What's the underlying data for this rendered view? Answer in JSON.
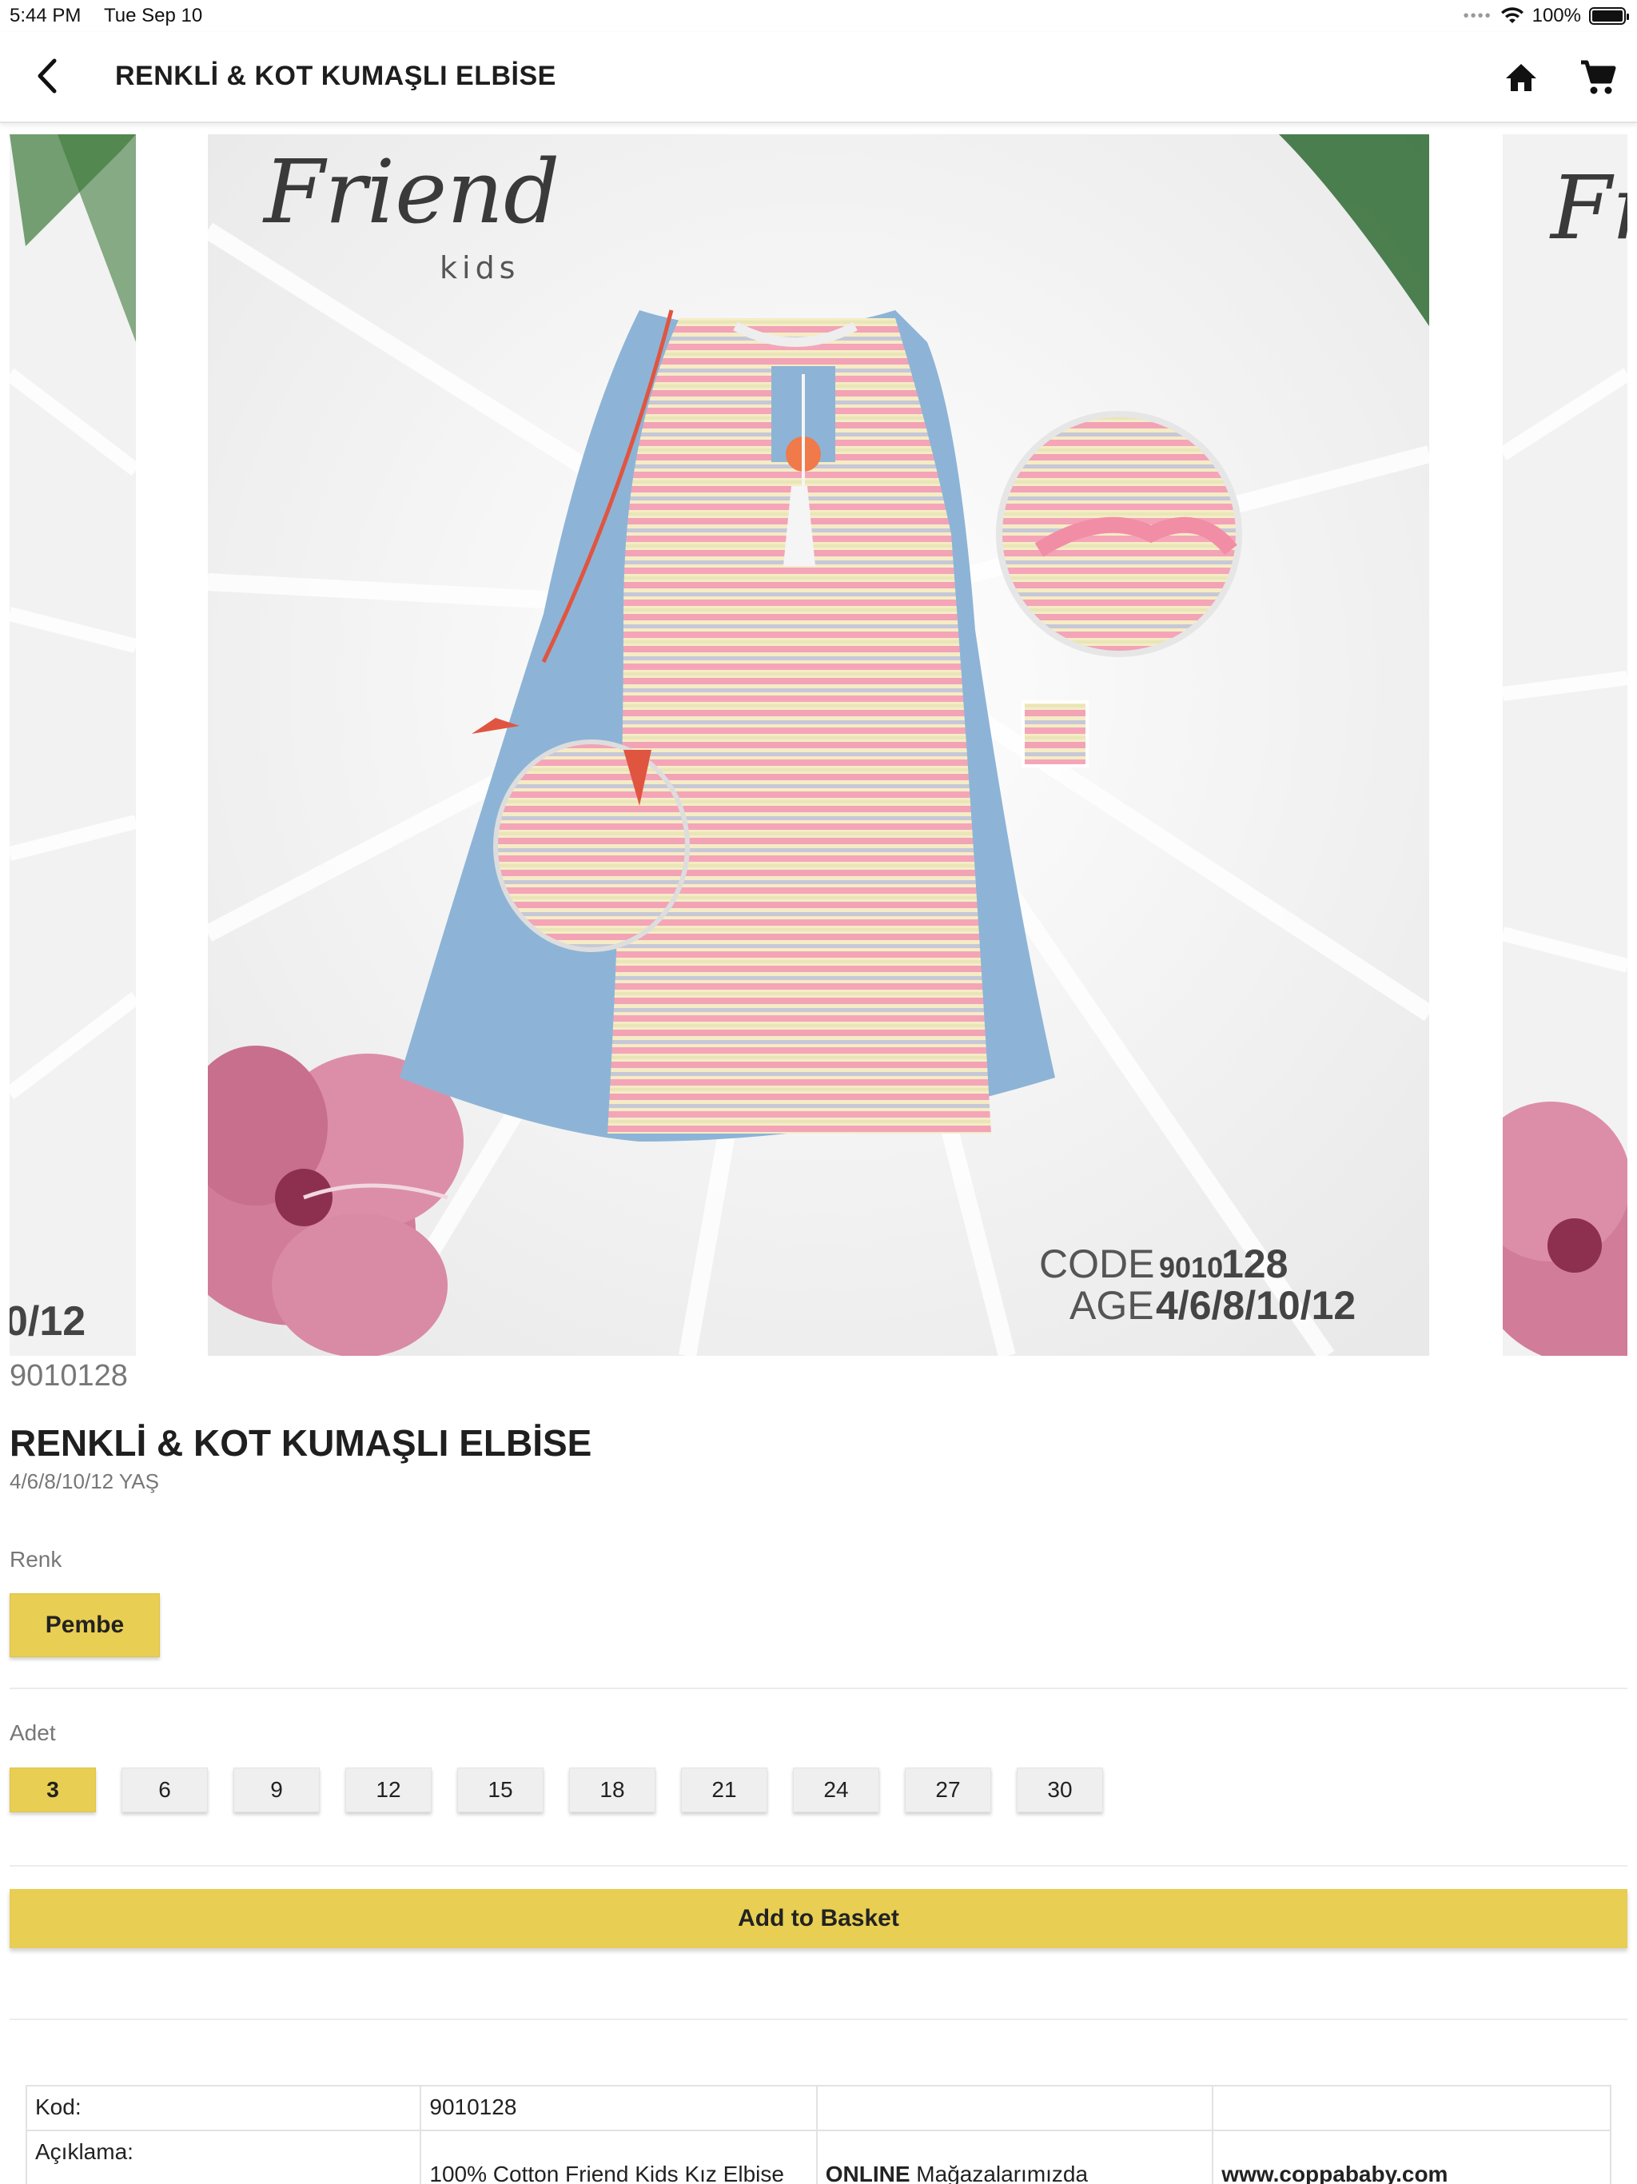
{
  "status_bar": {
    "time": "5:44 PM",
    "date": "Tue Sep 10",
    "battery": "100%"
  },
  "nav": {
    "title": "RENKLİ & KOT KUMAŞLI ELBİSE"
  },
  "gallery": {
    "brand": "Friend",
    "brand_sub": "kids",
    "code_label": "CODE",
    "code_prefix": "9010",
    "code_suffix": "128",
    "age_label": "AGE",
    "age_value": "4/6/8/10/12",
    "left_partial_text": "0/12",
    "right_partial_text": "Fr"
  },
  "product": {
    "code": "9010128",
    "title": "RENKLİ & KOT KUMAŞLI ELBİSE",
    "subtitle": "4/6/8/10/12 YAŞ"
  },
  "color_section": {
    "label": "Renk",
    "options": [
      "Pembe"
    ],
    "selected": "Pembe"
  },
  "quantity_section": {
    "label": "Adet",
    "options": [
      "3",
      "6",
      "9",
      "12",
      "15",
      "18",
      "21",
      "24",
      "27",
      "30"
    ],
    "selected": "3"
  },
  "add_to_basket_label": "Add to Basket",
  "details_table": {
    "row1": [
      "Kod:",
      "9010128",
      "",
      ""
    ],
    "row2": {
      "label": "Açıklama:",
      "description": "100% Cotton Friend Kids Kız Elbise",
      "online_bold": "ONLINE",
      "online_rest": " Mağazalarımızda",
      "website": "www.coppababy.com"
    }
  },
  "colors": {
    "accent": "#e8ce52",
    "chip_bg": "#efefef",
    "muted_text": "#777777"
  }
}
